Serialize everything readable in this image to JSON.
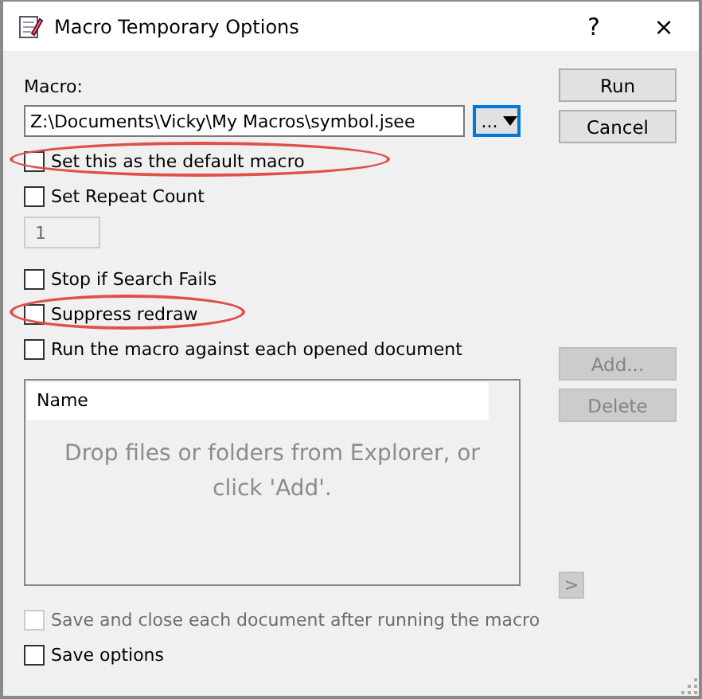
{
  "window": {
    "title": "Macro Temporary Options",
    "help": "?",
    "close": "×"
  },
  "macro": {
    "label": "Macro:",
    "value": "Z:\\Documents\\Vicky\\My Macros\\symbol.jsee",
    "browse": "..."
  },
  "options": [
    {
      "kind": "checkbox",
      "label": "Set this as the default macro",
      "checked": false,
      "disabled": false,
      "highlighted": true
    },
    {
      "kind": "checkbox",
      "label": "Set Repeat Count",
      "checked": false,
      "disabled": false,
      "highlighted": false
    },
    {
      "kind": "number",
      "value": "1",
      "disabled": true
    },
    {
      "kind": "checkbox",
      "label": "Stop if Search Fails",
      "checked": false,
      "disabled": false,
      "highlighted": false
    },
    {
      "kind": "checkbox",
      "label": "Suppress redraw",
      "checked": false,
      "disabled": false,
      "highlighted": true
    },
    {
      "kind": "checkbox",
      "label": "Run the macro against each opened document",
      "checked": false,
      "disabled": false,
      "highlighted": false
    }
  ],
  "file_list": {
    "column": "Name",
    "empty_text": "Drop files or folders from Explorer, or click 'Add'."
  },
  "bottom_options": [
    {
      "label": "Save and close each document after running the macro",
      "checked": false,
      "disabled": true
    },
    {
      "label": "Save options",
      "checked": false,
      "disabled": false
    }
  ],
  "buttons": [
    {
      "label": "Run",
      "disabled": false
    },
    {
      "label": "Cancel",
      "disabled": false
    }
  ],
  "list_buttons": [
    {
      "label": "Add...",
      "disabled": true
    },
    {
      "label": "Delete",
      "disabled": true
    }
  ],
  "move_button": {
    "label": ">",
    "disabled": true
  }
}
